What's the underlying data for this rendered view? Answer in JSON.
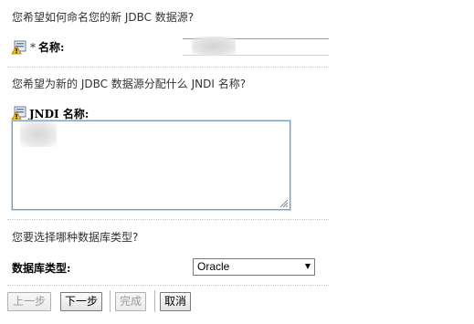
{
  "name_section": {
    "question": "您希望如何命名您的新 JDBC 数据源?",
    "required_marker": "*",
    "label": "名称:",
    "value": ""
  },
  "jndi_section": {
    "question": "您希望为新的 JDBC 数据源分配什么 JNDI 名称?",
    "label": "JNDI 名称:",
    "value": ""
  },
  "db_type_section": {
    "question": "您要选择哪种数据库类型?",
    "label": "数据库类型:",
    "selected": "Oracle"
  },
  "buttons": {
    "back": "上一步",
    "next": "下一步",
    "finish": "完成",
    "cancel": "取消"
  },
  "icons": {
    "name_info": "info-icon",
    "jndi_info": "info-icon",
    "resize_grip": "resize-grip-icon",
    "dropdown": "chevron-down-icon"
  }
}
